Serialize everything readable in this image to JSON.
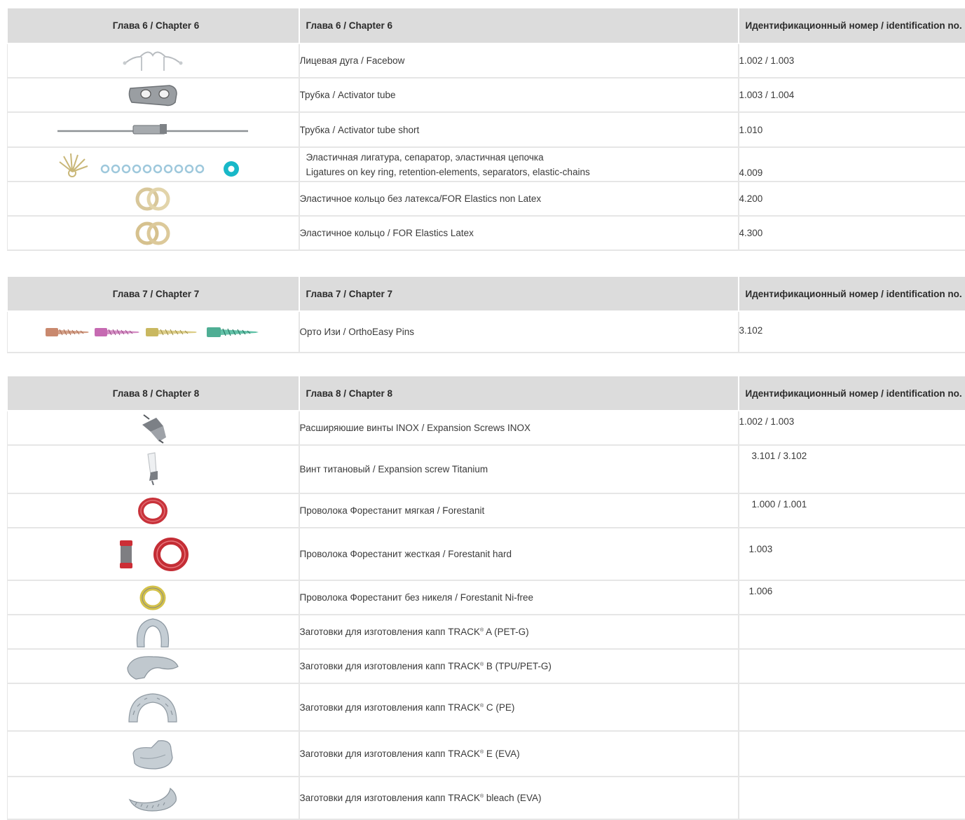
{
  "chapter6": {
    "header": {
      "col1": "Глава 6 / Chapter  6",
      "col2": "Глава 6 / Chapter  6",
      "col3": "Идентификационный номер  / identification no."
    },
    "rows": [
      {
        "icon": "facebow-icon",
        "desc": "Лицевая дуга / Facebow",
        "id": "1.002 / 1.003"
      },
      {
        "icon": "activator-tube-icon",
        "desc": "Трубка / Activator tube",
        "id": "1.003 / 1.004"
      },
      {
        "icon": "activator-tube-short-icon",
        "desc": "Трубка / Activator tube short",
        "id": "1.010"
      },
      {
        "icon": "ligatures-icon",
        "desc_line1": "Эластичная лигатура, сепаратор, эластичная цепочка",
        "desc_line2": "Ligatures on key ring, retention-elements, separators, elastic-chains",
        "id": "4.009"
      },
      {
        "icon": "elastic-rings-icon",
        "desc": "Эластичное кольцо без латекса/FOR Elastics non Latex",
        "id": "4.200"
      },
      {
        "icon": "elastic-rings-latex-icon",
        "desc": "Эластичное кольцо / FOR Elastics Latex",
        "id": "4.300"
      }
    ]
  },
  "chapter7": {
    "header": {
      "col1": "Глава 7 / Chapter  7",
      "col2": "Глава 7 / Chapter  7",
      "col3": "Идентификационный номер  / identification no."
    },
    "rows": [
      {
        "icon": "ortho-pins-icon",
        "desc": "Орто Изи / OrthoEasy Pins",
        "id": "3.102"
      }
    ]
  },
  "chapter8": {
    "header": {
      "col1": "Глава 8 / Chapter  8",
      "col2": "Глава 8 / Chapter  8",
      "col3": "Идентификационный номер  / identification no."
    },
    "rows": [
      {
        "icon": "expansion-screw-icon",
        "desc": "Расширяюшие винты INOX  / Expansion Screws INOX",
        "id": "1.002 / 1.003"
      },
      {
        "icon": "titanium-screw-icon",
        "desc": "Винт титановый  / Expansion screw Titanium",
        "id": "3.101 / 3.102"
      },
      {
        "icon": "wire-coil-red-icon",
        "desc": "Проволока Форестанит мягкая / Forestanit",
        "id": "1.000 / 1.001"
      },
      {
        "icon": "wire-spool-hard-icon",
        "desc": "Проволока Форестанит жесткая / Forestanit hard",
        "id": "1.003"
      },
      {
        "icon": "wire-coil-gold-icon",
        "desc": "Проволока Форестанит без никеля / Forestanit Ni-free",
        "id": "1.006"
      },
      {
        "icon": "aligner-a-icon",
        "desc_pre": "Заготовки для изготовления капп TRACK",
        "sup": "®",
        "desc_post": " A  (PET-G)",
        "id": ""
      },
      {
        "icon": "aligner-b-icon",
        "desc_pre": "Заготовки для изготовления капп TRACK",
        "sup": "®",
        "desc_post": " B  (TPU/PET-G)",
        "id": ""
      },
      {
        "icon": "aligner-c-icon",
        "desc_pre": "Заготовки для изготовления капп TRACK",
        "sup": "®",
        "desc_post": " C  (PE)",
        "id": ""
      },
      {
        "icon": "aligner-e-icon",
        "desc_pre": "Заготовки для изготовления капп TRACK",
        "sup": "®",
        "desc_post": " E  (EVA)",
        "id": ""
      },
      {
        "icon": "aligner-bleach-icon",
        "desc_pre": "Заготовки для изготовления капп TRACK",
        "sup": "®",
        "desc_post": " bleach  (EVA)",
        "id": ""
      }
    ]
  }
}
